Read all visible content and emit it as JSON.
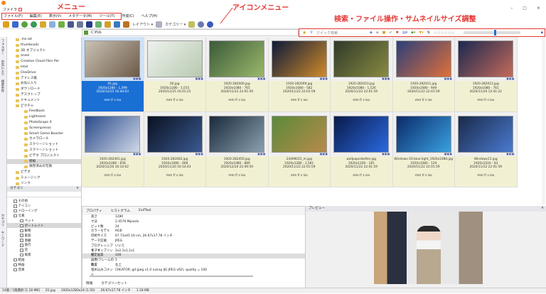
{
  "annotations": {
    "menu": "メニュー",
    "icon_menu": "アイコンメニュー",
    "search_tools": "検索・ファイル操作・サムネイルサイズ調整"
  },
  "window": {
    "tab": "ファイラ",
    "controls": [
      "–",
      "▢",
      "×"
    ]
  },
  "menu": [
    "ファイル(F)",
    "編集(E)",
    "表示(V)",
    "メタデータ(M)",
    "ツール(T)",
    "作成(C)",
    "ヘルプ(H)"
  ],
  "toolbar": {
    "layout": "レイアウト ▾",
    "category": "カテゴリー ▾"
  },
  "address": {
    "path": "C:¥Us"
  },
  "search": {
    "placeholder": "クイック検索",
    "rating": "☆☆☆☆☆☆",
    "thumb_size": 0.55
  },
  "vtabs": [
    "フォルダー",
    "お気に入り",
    "検索条件"
  ],
  "vtabs_bottom": [
    "カテゴリ",
    "キーワード"
  ],
  "tree": [
    {
      "l": ".ms-ad",
      "d": 1
    },
    {
      "l": "thumbnails",
      "d": 1
    },
    {
      "l": "3D オブジェクト",
      "d": 1
    },
    {
      "l": "ansel",
      "d": 1
    },
    {
      "l": "Creative Cloud Files Per",
      "d": 1
    },
    {
      "l": "Intel",
      "d": 1
    },
    {
      "l": "OneDrive",
      "d": 1
    },
    {
      "l": "アドレス帳",
      "d": 1
    },
    {
      "l": "お気に入り",
      "d": 1
    },
    {
      "l": "ダウンロード",
      "d": 1
    },
    {
      "l": "デスクトップ",
      "d": 1
    },
    {
      "l": "ドキュメント",
      "d": 1
    },
    {
      "l": "ピクチャ",
      "d": 1
    },
    {
      "l": "Feedback",
      "d": 2
    },
    {
      "l": "Lightroom",
      "d": 2
    },
    {
      "l": "PhotoScape X",
      "d": 2
    },
    {
      "l": "Screenpresso",
      "d": 2
    },
    {
      "l": "Smart Game Booster",
      "d": 2
    },
    {
      "l": "カメラロール",
      "d": 2
    },
    {
      "l": "スクリーンショット",
      "d": 2
    },
    {
      "l": "スクリーンショット",
      "d": 2
    },
    {
      "l": "ビデオ プロジェクト",
      "d": 2
    },
    {
      "l": "壁紙",
      "d": 2,
      "sel": true
    },
    {
      "l": "保存済みの写真",
      "d": 2
    },
    {
      "l": "ビデオ",
      "d": 1
    },
    {
      "l": "ミュージック",
      "d": 1
    },
    {
      "l": "リンク",
      "d": 1
    }
  ],
  "thumbnails": [
    {
      "name": "01.jpg",
      "size": "1920x1280 - 1,399",
      "date": "2020/12/25 16:44:03",
      "meta": "mm f/ s iso",
      "selected": true,
      "c1": "#c9c2b5",
      "c2": "#6d5a48"
    },
    {
      "name": "00.jpg",
      "size": "1920x1280 - 1,015",
      "date": "2020/12/25 16:01:25",
      "meta": "mm f/ s iso",
      "c1": "#eef2ee",
      "c2": "#b7c9b0"
    },
    {
      "name": "1920-282000.jpg",
      "size": "1920x1080 - 765",
      "date": "2020/11/22 22:01:59",
      "meta": "mm f/ s iso",
      "c1": "#3a5a3a",
      "c2": "#9bb86a"
    },
    {
      "name": "1920-282009.jpg",
      "size": "1920x1080 - 582",
      "date": "2020/11/22 22:01:59",
      "meta": "mm f/ s iso",
      "c1": "#0c1a3a",
      "c2": "#d08a2a"
    },
    {
      "name": "1920-282010.jpg",
      "size": "1920x1080 - 1,526",
      "date": "2020/11/22 22:01:59",
      "meta": "mm f/ s iso",
      "c1": "#2e3a2a",
      "c2": "#8a8a40"
    },
    {
      "name": "1920-282011.jpg",
      "size": "1920x1080 - 949",
      "date": "2020/11/22 22:01:59",
      "meta": "mm f/ s iso",
      "c1": "#2a3f7a",
      "c2": "#e0703a"
    },
    {
      "name": "1920-282012.jpg",
      "size": "1920x1080 - 761",
      "date": "2020/11/20 12:41:22",
      "meta": "mm f/ s iso",
      "c1": "#1a2850",
      "c2": "#c46a5a"
    },
    {
      "name": "1920-282461.jpg",
      "size": "1920x1080 - 658",
      "date": "2020/12/20 16:14:02",
      "meta": "mm f/ s iso",
      "c1": "#2a4a8a",
      "c2": "#cfd8e8"
    },
    {
      "name": "1920-282462.jpg",
      "size": "1920x1080 - 468",
      "date": "2020/11/20 16:14:43",
      "meta": "mm f/ s iso",
      "c1": "#0a1020",
      "c2": "#3a5a90"
    },
    {
      "name": "1920-282450.jpg",
      "size": "1920x1080 - 889",
      "date": "2020/12/20 22:09:59",
      "meta": "mm f/ s iso",
      "c1": "#1a2a3a",
      "c2": "#8aa0b0"
    },
    {
      "name": "24409015_m.jpg",
      "size": "1920x1280 - 1,581",
      "date": "2020/11/22 22:01:59",
      "meta": "mm f/ s iso",
      "c1": "#5a8a3a",
      "c2": "#b88a4a"
    },
    {
      "name": "wallpaperbetter.jpg",
      "size": "1920x1200 - 181",
      "date": "2020/11/22 22:01:59",
      "meta": "mm f/ s iso",
      "c1": "#0a1a4a",
      "c2": "#2a6ae0"
    },
    {
      "name": "Windows-10-blue-light_1920x1080.jpg",
      "size": "1920x1080 - 129",
      "date": "2020/11/22 22:01:59",
      "meta": "mm f/ s iso",
      "c1": "#0a2a6a",
      "c2": "#3aa0e0"
    },
    {
      "name": "Windows11.jpg",
      "size": "1920x1020 - 83",
      "date": "2020/11/22 22:01:59",
      "meta": "mm f/ s iso",
      "c1": "#1a2a4a",
      "c2": "#4a7ad0"
    }
  ],
  "category": {
    "title": "カテゴリ",
    "items": [
      {
        "l": "その他",
        "d": 1
      },
      {
        "l": "アイコン",
        "d": 1
      },
      {
        "l": "ドローイング",
        "d": 1
      },
      {
        "l": "写真",
        "d": 1
      },
      {
        "l": "ペット",
        "d": 2
      },
      {
        "l": "ポートレイト",
        "d": 2,
        "sel": true
      },
      {
        "l": "動物",
        "d": 2
      },
      {
        "l": "家族",
        "d": 2
      },
      {
        "l": "景観",
        "d": 2
      },
      {
        "l": "旅行",
        "d": 2
      },
      {
        "l": "花",
        "d": 2
      },
      {
        "l": "風景",
        "d": 2
      },
      {
        "l": "絵画",
        "d": 1
      },
      {
        "l": "映画",
        "d": 1
      },
      {
        "l": "音楽",
        "d": 1
      }
    ]
  },
  "properties": {
    "tabs": [
      "プロパティ",
      "ヒストグラム",
      "ExifTool"
    ],
    "rows": [
      {
        "k": "高さ",
        "v": "1280"
      },
      {
        "k": "寸法",
        "v": "2.4576 Mpixels"
      },
      {
        "k": "ビット数",
        "v": "24"
      },
      {
        "k": "カラーモデル",
        "v": "RGB"
      },
      {
        "k": "印刷サイズ",
        "v": "67.73x45.16 cm, 26.67x17.78 インチ"
      },
      {
        "k": "データ圧縮",
        "v": "JPEG"
      },
      {
        "k": "プログレッシブモード",
        "v": "いいえ"
      },
      {
        "k": "サブサンプリング",
        "v": "2x2,1x1,1x1"
      },
      {
        "k": "推定画質",
        "v": "100",
        "hl": true
      },
      {
        "k": "画像/フレームの数",
        "v": "1"
      },
      {
        "k": "位置",
        "v": "左上"
      },
      {
        "k": "埋め込みコメント",
        "v": "CREATOR: gd-jpeg v1.0 (using IJG JPEG v62), quality = 100"
      }
    ],
    "bottom_tabs": [
      "情報",
      "カテゴリーセット"
    ]
  },
  "preview": {
    "title": "プレビュー"
  },
  "status": [
    "14個 / 1個選択 [1.18 MB]",
    "01.jpg",
    "1920x1280x24 (1.50)",
    "26.67x17.78 インチ",
    "1.18 MB"
  ]
}
